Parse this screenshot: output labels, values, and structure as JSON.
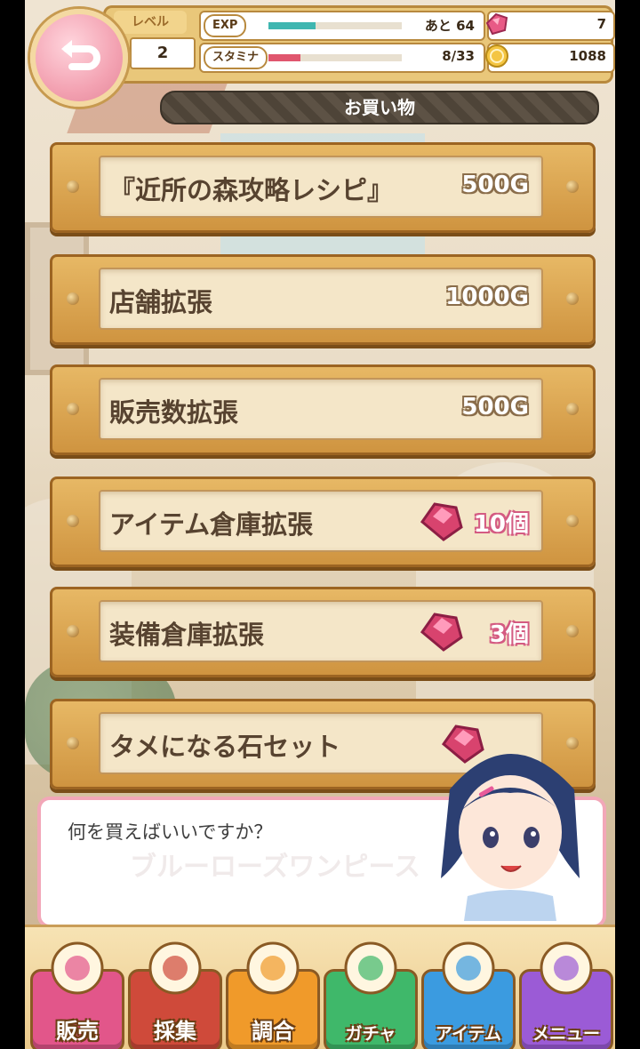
{
  "header": {
    "level_label": "レベル",
    "level_value": "2",
    "exp_label": "EXP",
    "exp_value": "あと 64",
    "exp_fill": 0.35,
    "stamina_label": "スタミナ",
    "stamina_value": "8/33",
    "stamina_fill": 0.24,
    "gems": "7",
    "gold": "1088"
  },
  "title": "お買い物",
  "items": [
    {
      "name": "『近所の森攻略レシピ』",
      "price": "500G",
      "currency": "gold"
    },
    {
      "name": "店舗拡張",
      "price": "1000G",
      "currency": "gold"
    },
    {
      "name": "販売数拡張",
      "price": "500G",
      "currency": "gold"
    },
    {
      "name": "アイテム倉庫拡張",
      "price": "10個",
      "currency": "gem"
    },
    {
      "name": "装備倉庫拡張",
      "price": "3個",
      "currency": "gem"
    },
    {
      "name": "タメになる石セット",
      "price": "",
      "currency": "gem"
    }
  ],
  "dialog": {
    "message": "何を買えばいいですか？",
    "background_text": "ブルーローズワンピース"
  },
  "nav": [
    {
      "label": "販売",
      "color": "#e2568a"
    },
    {
      "label": "採集",
      "color": "#cf4a3a"
    },
    {
      "label": "調合",
      "color": "#f09a2a"
    },
    {
      "label": "ガチャ",
      "color": "#3fb86a"
    },
    {
      "label": "アイテム",
      "color": "#3b9be0"
    },
    {
      "label": "メニュー",
      "color": "#9b5bd6"
    }
  ],
  "colors": {
    "exp_bar": "#3fb6b0",
    "stamina_bar": "#e0566e",
    "accent_pink": "#f2a7b8"
  }
}
